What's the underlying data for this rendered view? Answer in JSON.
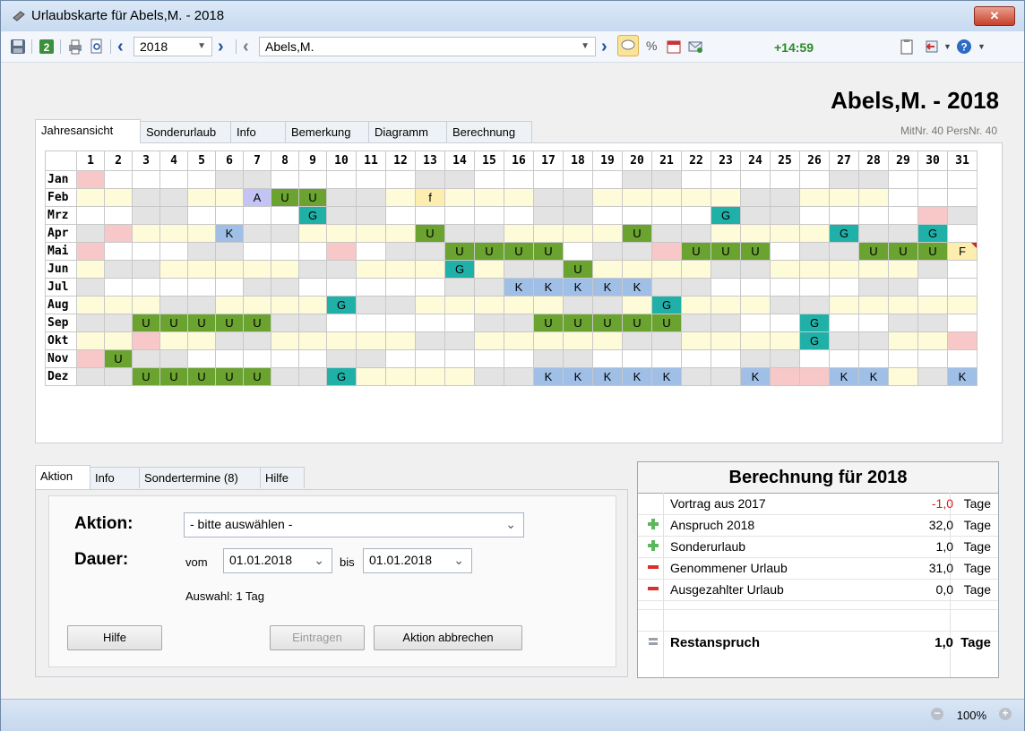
{
  "window": {
    "title": "Urlaubskarte für Abels,M. - 2018",
    "close": "✕"
  },
  "toolbar": {
    "year": "2018",
    "employee": "Abels,M.",
    "time": "+14:59"
  },
  "header": {
    "name_year": "Abels,M. - 2018",
    "mitnr": "MitNr. 40   PersNr. 40"
  },
  "tabs": [
    "Jahresansicht",
    "Sonderurlaub",
    "Info",
    "Bemerkung",
    "Diagramm",
    "Berechnung"
  ],
  "calendar": {
    "days": [
      "1",
      "2",
      "3",
      "4",
      "5",
      "6",
      "7",
      "8",
      "9",
      "10",
      "11",
      "12",
      "13",
      "14",
      "15",
      "16",
      "17",
      "18",
      "19",
      "20",
      "21",
      "22",
      "23",
      "24",
      "25",
      "26",
      "27",
      "28",
      "29",
      "30",
      "31"
    ],
    "months": [
      {
        "name": "Jan",
        "cells": [
          "P",
          "W",
          "W",
          "W",
          "W",
          "Gr",
          "Gr",
          "W",
          "W",
          "W",
          "W",
          "W",
          "Gr",
          "Gr",
          "W",
          "W",
          "W",
          "W",
          "W",
          "Gr",
          "Gr",
          "W",
          "W",
          "W",
          "W",
          "W",
          "Gr",
          "Gr",
          "W",
          "W",
          "W"
        ]
      },
      {
        "name": "Feb",
        "cells": [
          "Y",
          "Y",
          "Gr",
          "Gr",
          "Y",
          "Y",
          "A",
          "U",
          "U",
          "Gr",
          "Gr",
          "Y",
          "f",
          "Y",
          "Y",
          "Y",
          "Gr",
          "Gr",
          "Y",
          "Y",
          "Y",
          "Y",
          "Y",
          "Gr",
          "Gr",
          "Y",
          "Y",
          "Y",
          "x",
          "x",
          "x"
        ]
      },
      {
        "name": "Mrz",
        "cells": [
          "W",
          "W",
          "Gr",
          "Gr",
          "W",
          "W",
          "W",
          "W",
          "G",
          "Gr",
          "Gr",
          "W",
          "W",
          "W",
          "W",
          "W",
          "Gr",
          "Gr",
          "W",
          "W",
          "W",
          "W",
          "G",
          "Gr",
          "Gr",
          "W",
          "W",
          "W",
          "W",
          "P",
          "Gr"
        ]
      },
      {
        "name": "Apr",
        "cells": [
          "Gr",
          "P",
          "Y",
          "Y",
          "Y",
          "K",
          "Gr",
          "Gr",
          "Y",
          "Y",
          "Y",
          "Y",
          "U",
          "Gr",
          "Gr",
          "Y",
          "Y",
          "Y",
          "Y",
          "U",
          "Gr",
          "Gr",
          "Y",
          "Y",
          "Y",
          "Y",
          "G",
          "Gr",
          "Gr",
          "G",
          "x"
        ]
      },
      {
        "name": "Mai",
        "cells": [
          "P",
          "W",
          "W",
          "W",
          "Gr",
          "Gr",
          "W",
          "W",
          "W",
          "P",
          "W",
          "Gr",
          "Gr",
          "U",
          "U",
          "U",
          "U",
          "W",
          "Gr",
          "Gr",
          "P",
          "U",
          "U",
          "U",
          "W",
          "Gr",
          "Gr",
          "U",
          "U",
          "U",
          "F"
        ]
      },
      {
        "name": "Jun",
        "cells": [
          "Y",
          "Gr",
          "Gr",
          "Y",
          "Y",
          "Y",
          "Y",
          "Y",
          "Gr",
          "Gr",
          "Y",
          "Y",
          "Y",
          "G",
          "Y",
          "Gr",
          "Gr",
          "U",
          "Y",
          "Y",
          "Y",
          "Y",
          "Gr",
          "Gr",
          "Y",
          "Y",
          "Y",
          "Y",
          "Y",
          "Gr",
          "x"
        ]
      },
      {
        "name": "Jul",
        "cells": [
          "Gr",
          "W",
          "W",
          "W",
          "W",
          "W",
          "Gr",
          "Gr",
          "W",
          "W",
          "W",
          "W",
          "W",
          "Gr",
          "Gr",
          "K",
          "K",
          "K",
          "K",
          "K",
          "Gr",
          "Gr",
          "W",
          "W",
          "W",
          "W",
          "W",
          "Gr",
          "Gr",
          "W",
          "W"
        ]
      },
      {
        "name": "Aug",
        "cells": [
          "Y",
          "Y",
          "Y",
          "Gr",
          "Gr",
          "Y",
          "Y",
          "Y",
          "Y",
          "G",
          "Gr",
          "Gr",
          "Y",
          "Y",
          "Y",
          "Y",
          "Y",
          "Gr",
          "Gr",
          "Y",
          "G",
          "Y",
          "Y",
          "Y",
          "Gr",
          "Gr",
          "Y",
          "Y",
          "Y",
          "Y",
          "Y"
        ]
      },
      {
        "name": "Sep",
        "cells": [
          "Gr",
          "Gr",
          "U",
          "U",
          "U",
          "U",
          "U",
          "Gr",
          "Gr",
          "W",
          "W",
          "W",
          "W",
          "W",
          "Gr",
          "Gr",
          "U",
          "U",
          "U",
          "U",
          "U",
          "Gr",
          "Gr",
          "W",
          "W",
          "G",
          "W",
          "W",
          "Gr",
          "Gr",
          "x"
        ]
      },
      {
        "name": "Okt",
        "cells": [
          "Y",
          "Y",
          "P",
          "Y",
          "Y",
          "Gr",
          "Gr",
          "Y",
          "Y",
          "Y",
          "Y",
          "Y",
          "Gr",
          "Gr",
          "Y",
          "Y",
          "Y",
          "Y",
          "Y",
          "Gr",
          "Gr",
          "Y",
          "Y",
          "Y",
          "Y",
          "G",
          "Gr",
          "Gr",
          "Y",
          "Y",
          "P"
        ]
      },
      {
        "name": "Nov",
        "cells": [
          "P",
          "U",
          "Gr",
          "Gr",
          "W",
          "W",
          "W",
          "W",
          "W",
          "Gr",
          "Gr",
          "W",
          "W",
          "W",
          "W",
          "W",
          "Gr",
          "Gr",
          "W",
          "W",
          "W",
          "W",
          "W",
          "Gr",
          "Gr",
          "W",
          "W",
          "W",
          "W",
          "W",
          "x"
        ]
      },
      {
        "name": "Dez",
        "cells": [
          "Gr",
          "Gr",
          "U",
          "U",
          "U",
          "U",
          "U",
          "Gr",
          "Gr",
          "G",
          "Y",
          "Y",
          "Y",
          "Y",
          "Gr",
          "Gr",
          "K",
          "K",
          "K",
          "K",
          "K",
          "Gr",
          "Gr",
          "K",
          "P",
          "P",
          "K",
          "K",
          "Y",
          "Gr",
          "K"
        ]
      }
    ]
  },
  "bottom_tabs": [
    "Aktion",
    "Info",
    "Sondertermine (8)",
    "Hilfe"
  ],
  "action": {
    "aktion_label": "Aktion:",
    "aktion_value": "- bitte auswählen -",
    "dauer_label": "Dauer:",
    "vom_label": "vom",
    "vom_value": "01.01.2018",
    "bis_label": "bis",
    "bis_value": "01.01.2018",
    "auswahl": "Auswahl:  1 Tag",
    "btn_hilfe": "Hilfe",
    "btn_eintragen": "Eintragen",
    "btn_abbrechen": "Aktion abbrechen"
  },
  "calc": {
    "title": "Berechnung für 2018",
    "rows": [
      {
        "icon": "none",
        "label": "Vortrag aus 2017",
        "value": "-1,0",
        "unit": "Tage",
        "color": "#d62020"
      },
      {
        "icon": "plus",
        "label": "Anspruch 2018",
        "value": "32,0",
        "unit": "Tage",
        "color": "#000000"
      },
      {
        "icon": "plus",
        "label": "Sonderurlaub",
        "value": "1,0",
        "unit": "Tage",
        "color": "#000000"
      },
      {
        "icon": "minus",
        "label": "Genommener Urlaub",
        "value": "31,0",
        "unit": "Tage",
        "color": "#000000"
      },
      {
        "icon": "minus",
        "label": "Ausgezahlter Urlaub",
        "value": "0,0",
        "unit": "Tage",
        "color": "#000000"
      }
    ],
    "total_label": "Restanspruch",
    "total_value": "1,0",
    "total_unit": "Tage"
  },
  "status": {
    "zoom": "100%"
  },
  "colors": {
    "urlaub": "#6aa32f",
    "gleitzeit": "#1fb0a8",
    "krank": "#9fbfe6",
    "arzt": "#c3c4f5",
    "feiertag": "#f8c7c7",
    "wochenende": "#e3e3e3"
  }
}
